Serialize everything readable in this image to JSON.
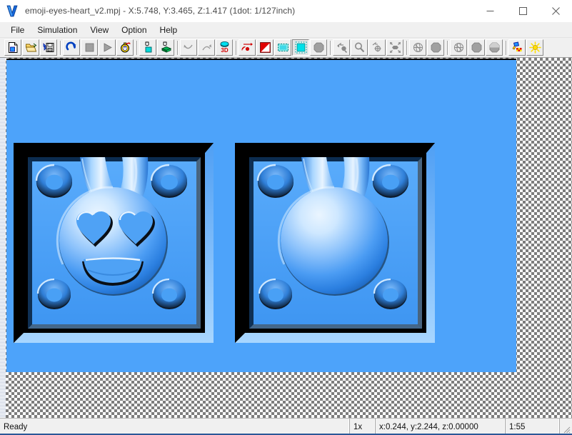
{
  "window": {
    "logo_icon": "v-logo-icon",
    "title": "emoji-eyes-heart_v2.mpj - X:5.748, Y:3.465, Z:1.417 (1dot: 1/127inch)",
    "file_name": "emoji-eyes-heart_v2.mpj",
    "dimensions": {
      "x": "5.748",
      "y": "3.465",
      "z": "1.417",
      "resolution_note": "1dot: 1/127inch"
    },
    "controls": [
      {
        "name": "minimize-button",
        "icon": "minimize-icon",
        "label": "–"
      },
      {
        "name": "maximize-button",
        "icon": "maximize-icon",
        "label": "☐"
      },
      {
        "name": "close-button",
        "icon": "close-icon",
        "label": "✕"
      }
    ]
  },
  "menubar": {
    "items": [
      {
        "label": "File"
      },
      {
        "label": "Simulation"
      },
      {
        "label": "View"
      },
      {
        "label": "Option"
      },
      {
        "label": "Help"
      }
    ]
  },
  "toolbar": {
    "groups": [
      {
        "buttons": [
          {
            "name": "new-file-button",
            "icon": "new-document-icon",
            "tooltip": "New"
          },
          {
            "name": "open-file-button",
            "icon": "open-folder-icon",
            "tooltip": "Open"
          },
          {
            "name": "save-file-button",
            "icon": "save-disk-icon",
            "tooltip": "Save"
          }
        ]
      },
      {
        "buttons": [
          {
            "name": "reset-simulation-button",
            "icon": "redo-arrow-icon",
            "tooltip": "Reset"
          },
          {
            "name": "stop-simulation-button",
            "icon": "stop-square-icon",
            "tooltip": "Stop"
          },
          {
            "name": "play-simulation-button",
            "icon": "play-triangle-icon",
            "tooltip": "Play"
          },
          {
            "name": "simulation-speed-button",
            "icon": "stopwatch-icon",
            "tooltip": "Speed"
          }
        ]
      },
      {
        "buttons": [
          {
            "name": "stock-block-button",
            "icon": "stock-block-icon",
            "tooltip": "Stock"
          },
          {
            "name": "material-block-button",
            "icon": "material-block-icon",
            "tooltip": "Material"
          }
        ]
      },
      {
        "buttons": [
          {
            "name": "rotate-left-button",
            "icon": "rotate-left-arrow-icon",
            "tooltip": "Rotate Left"
          },
          {
            "name": "rotate-right-button",
            "icon": "rotate-right-arrow-icon",
            "tooltip": "Rotate Right"
          },
          {
            "name": "view-3d-button",
            "icon": "3d-view-icon",
            "tooltip": "3D View"
          }
        ]
      },
      {
        "buttons": [
          {
            "name": "toolpath-button",
            "icon": "toolpath-arrow-icon",
            "tooltip": "Toolpath"
          },
          {
            "name": "render-quality-button",
            "icon": "red-triangle-icon",
            "tooltip": "Render"
          },
          {
            "name": "select-region-button",
            "icon": "dashed-selection-icon",
            "tooltip": "Select Region"
          },
          {
            "name": "crop-region-button",
            "icon": "dashed-crop-icon",
            "tooltip": "Crop"
          },
          {
            "name": "solid-shape-button",
            "icon": "gray-octagon-icon",
            "tooltip": "Solid"
          }
        ]
      },
      {
        "buttons": [
          {
            "name": "orbit-view-button",
            "icon": "orbit-arrows-icon",
            "tooltip": "Orbit"
          },
          {
            "name": "zoom-view-button",
            "icon": "magnifier-icon",
            "tooltip": "Zoom"
          },
          {
            "name": "pan-view-button",
            "icon": "pan-move-icon",
            "tooltip": "Pan"
          },
          {
            "name": "fit-view-button",
            "icon": "fit-to-window-icon",
            "tooltip": "Fit"
          }
        ]
      },
      {
        "buttons": [
          {
            "name": "wireframe-sphere-button",
            "icon": "wireframe-globe-icon",
            "tooltip": "Wireframe"
          },
          {
            "name": "flat-shade-button",
            "icon": "flat-octagon-icon",
            "tooltip": "Flat Shading"
          }
        ]
      },
      {
        "buttons": [
          {
            "name": "wireframe-globe-2-button",
            "icon": "wireframe-globe-icon",
            "tooltip": "Wireframe"
          },
          {
            "name": "solid-octagon-button",
            "icon": "gray-octagon-icon",
            "tooltip": "Solid"
          },
          {
            "name": "shaded-octagon-button",
            "icon": "shaded-octagon-icon",
            "tooltip": "Shaded"
          }
        ]
      },
      {
        "buttons": [
          {
            "name": "material-color-button",
            "icon": "paint-color-icon",
            "tooltip": "Material Color"
          },
          {
            "name": "light-settings-button",
            "icon": "sun-light-icon",
            "tooltip": "Lighting"
          }
        ]
      }
    ]
  },
  "viewport": {
    "name": "3d-simulation-canvas",
    "background_color": "#4da3fa",
    "models": [
      {
        "name": "emoji-heart-eyes-mold",
        "description": "Square mold plate with embossed sphere, heart-shaped eyes, open smile and two sprue channels",
        "has_face": true,
        "corner_holes": 4,
        "sprue_channels": 2
      },
      {
        "name": "plain-sphere-mold",
        "description": "Square mold plate with embossed plain sphere and two sprue channels",
        "has_face": false,
        "corner_holes": 4,
        "sprue_channels": 2
      }
    ]
  },
  "statusbar": {
    "message": "Ready",
    "zoom": "1x",
    "coordinates": "x:0.244, y:2.244, z:0.00000",
    "time": "1:55"
  },
  "colors": {
    "canvas_blue": "#4da3fa",
    "model_blue_light": "#bfe0ff",
    "model_blue_mid": "#2f86e8",
    "model_shadow": "#000000",
    "chrome_gray": "#f0f0f0",
    "accent": "#2b5797"
  }
}
